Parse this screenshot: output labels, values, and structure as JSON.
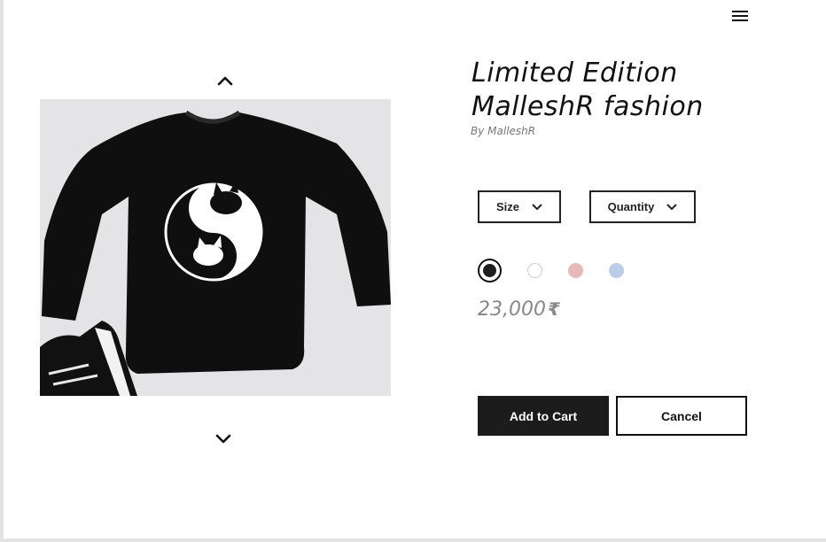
{
  "header": {
    "menu_icon": "hamburger-menu-icon"
  },
  "gallery": {
    "up_icon": "chevron-up-icon",
    "down_icon": "chevron-down-icon",
    "image": "black sweatshirt with yin-yang cats print"
  },
  "product": {
    "title_line1": "Limited Edition",
    "title_line2": "MalleshR fashion",
    "author": "By MalleshR",
    "size_label": "Size",
    "quantity_label": "Quantity",
    "colors": [
      {
        "name": "black",
        "hex": "#1e1e1e",
        "selected": true
      },
      {
        "name": "white",
        "hex": "#ffffff",
        "selected": false
      },
      {
        "name": "pink",
        "hex": "#e8b9b9",
        "selected": false
      },
      {
        "name": "blue",
        "hex": "#b9cde8",
        "selected": false
      }
    ],
    "price": "23,000",
    "currency_symbol": "₹"
  },
  "actions": {
    "add_to_cart": "Add to Cart",
    "cancel": "Cancel"
  }
}
